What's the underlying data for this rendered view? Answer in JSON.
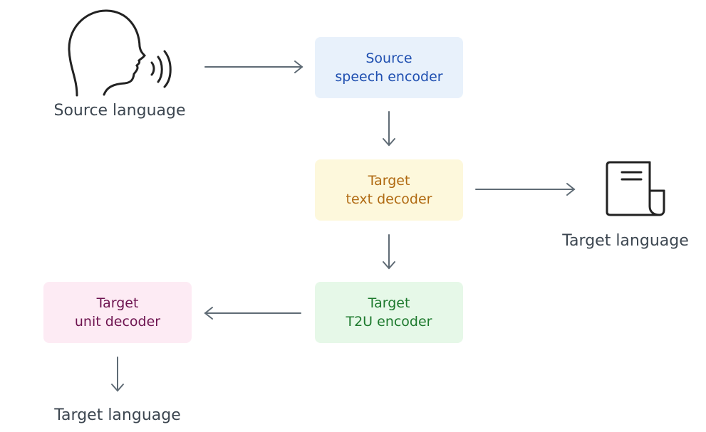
{
  "source_label": "Source language",
  "boxes": {
    "source_encoder": {
      "line1": "Source",
      "line2": "speech encoder",
      "bg": "#e8f1fb",
      "color": "#1f4fb0"
    },
    "text_decoder": {
      "line1": "Target",
      "line2": "text decoder",
      "bg": "#fdf8dc",
      "color": "#b06a12"
    },
    "t2u_encoder": {
      "line1": "Target",
      "line2": "T2U encoder",
      "bg": "#e6f8e8",
      "color": "#1e7a2e"
    },
    "unit_decoder": {
      "line1": "Target",
      "line2": "unit decoder",
      "bg": "#fdebf4",
      "color": "#6e1450"
    }
  },
  "text_output_label": "Target language",
  "speech_output_label": "Target language",
  "arrow_color": "#5f6b75",
  "icons": {
    "source": "speaking-head-icon",
    "text_output": "document-icon"
  }
}
